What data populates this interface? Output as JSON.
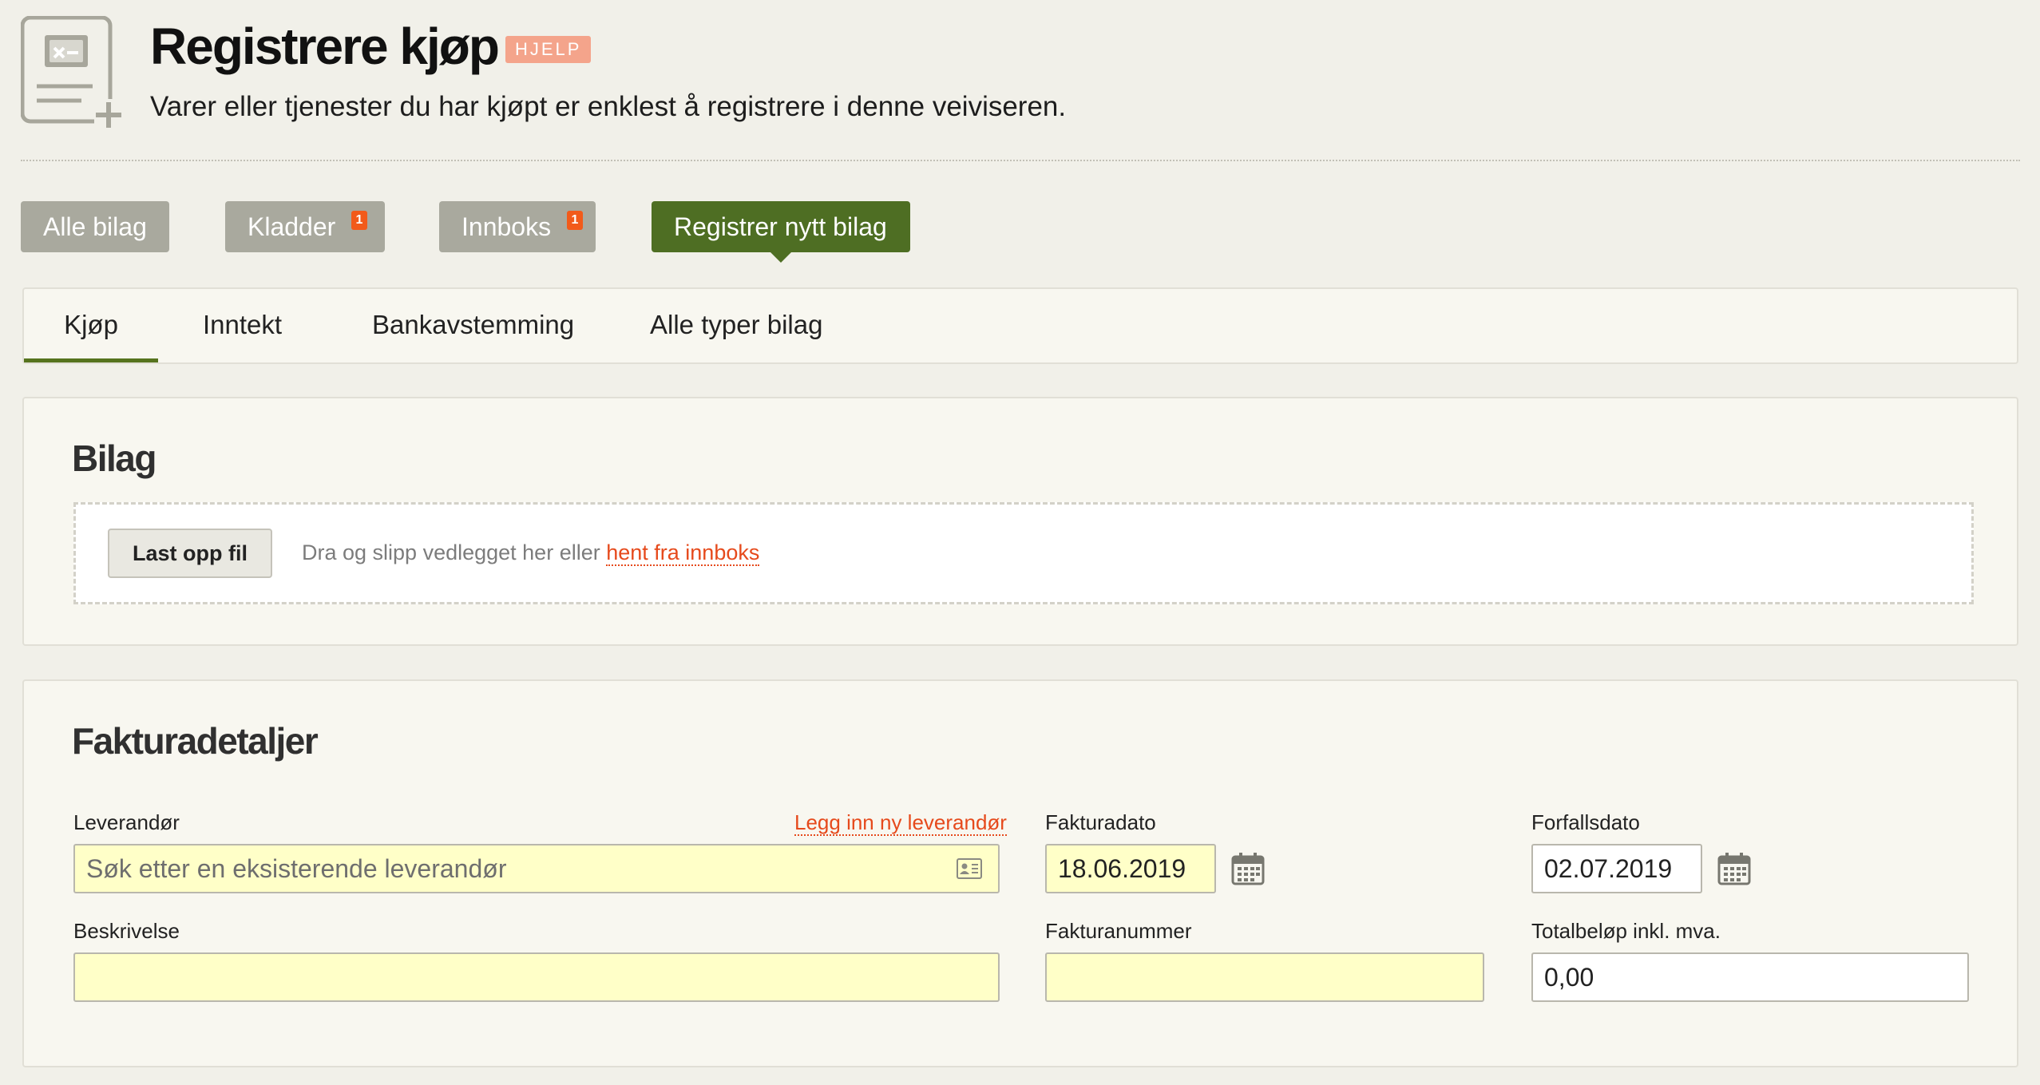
{
  "header": {
    "title": "Registrere kjøp",
    "help_badge": "HJELP",
    "subtitle": "Varer eller tjenester du har kjøpt er enklest å registrere i denne veiviseren."
  },
  "topnav": {
    "all_label": "Alle bilag",
    "drafts_label": "Kladder",
    "drafts_count": "1",
    "inbox_label": "Innboks",
    "inbox_count": "1",
    "register_label": "Registrer nytt bilag"
  },
  "tabs": {
    "purchase": "Kjøp",
    "income": "Inntekt",
    "bank": "Bankavstemming",
    "all_types": "Alle typer bilag"
  },
  "attachment": {
    "title": "Bilag",
    "upload_label": "Last opp fil",
    "drop_text": "Dra og slipp vedlegget her eller",
    "drop_link": "hent fra innboks"
  },
  "invoice": {
    "title": "Fakturadetaljer",
    "supplier_label": "Leverandør",
    "new_supplier_link": "Legg inn ny leverandør",
    "supplier_placeholder": "Søk etter en eksisterende leverandør",
    "invoice_date_label": "Fakturadato",
    "invoice_date_value": "18.06.2019",
    "due_date_label": "Forfallsdato",
    "due_date_value": "02.07.2019",
    "description_label": "Beskrivelse",
    "description_value": "",
    "invoice_number_label": "Fakturanummer",
    "invoice_number_value": "",
    "total_label": "Totalbeløp inkl. mva.",
    "total_value": "0,00"
  },
  "colors": {
    "accent_green": "#4e6e23",
    "badge_orange": "#f25a1a",
    "link_orange": "#e64a1c",
    "help_salmon": "#f4a48b",
    "input_yellow": "#ffffc8"
  }
}
